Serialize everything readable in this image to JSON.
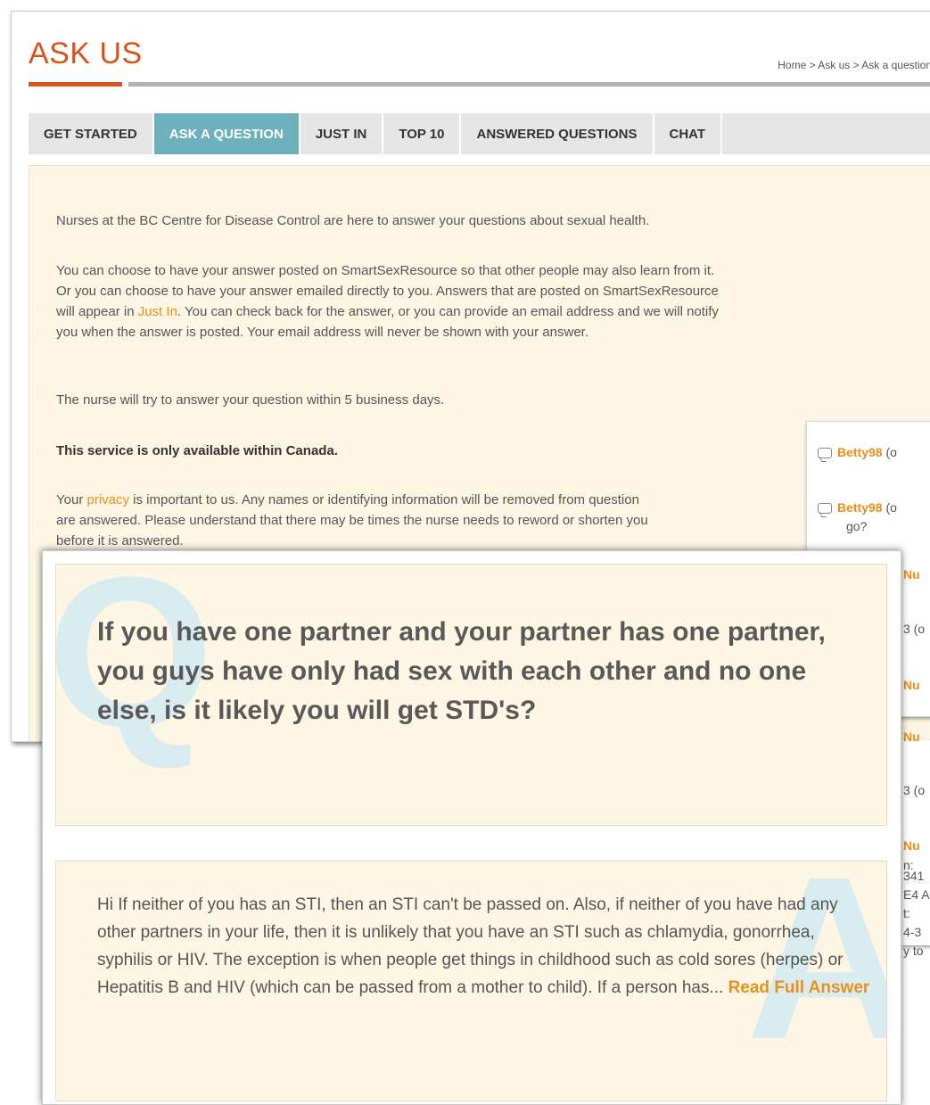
{
  "page": {
    "title": "ASK US",
    "breadcrumb": "Home > Ask us > Ask a question"
  },
  "tabs": [
    {
      "label": "GET STARTED",
      "active": false
    },
    {
      "label": "ASK A QUESTION",
      "active": true
    },
    {
      "label": "JUST IN",
      "active": false
    },
    {
      "label": "TOP 10",
      "active": false
    },
    {
      "label": "ANSWERED QUESTIONS",
      "active": false
    },
    {
      "label": "CHAT",
      "active": false
    }
  ],
  "intro": {
    "p1": "Nurses at the BC Centre for Disease Control are here to answer your questions about sexual health.",
    "p2_line1": "You can choose to have your answer posted on SmartSexResource so that other people may also learn from it.",
    "p2_line2": "Or you can choose to have your answer emailed directly to you. Answers that are posted on SmartSexResource",
    "p2_line3_pre": "will appear in ",
    "p2_line3_link": "Just In",
    "p2_line3_post": ". You can check back for the answer, or you can provide an email address and we will notify",
    "p2_line4": "you when the answer is posted. Your email address will never be shown with your answer.",
    "p3": "The nurse will try to answer your question within 5 business days.",
    "p4": "This service is only available within Canada.",
    "p5_line1_pre": "Your ",
    "p5_line1_link": "privacy",
    "p5_line1_post": " is important to us. Any names or identifying information will be removed from question",
    "p5_line2": "are answered. Please understand that there may be times the nurse needs to reword or shorten you",
    "p5_line3": "before it is answered."
  },
  "side_panel": {
    "comments": [
      {
        "user": "Betty98",
        "suffix": "(o"
      },
      {
        "user": "Betty98",
        "suffix": "(o",
        "extra": "go?"
      }
    ],
    "snippets": [
      "Nu",
      "3 (o",
      "Nu",
      "Nu",
      "3 (o",
      "Nu",
      "n:",
      "341",
      "E4 A",
      "t:",
      "4-3",
      "y to"
    ]
  },
  "question": {
    "text": "If you have one partner and your partner has one partner, you guys have only had sex with each other and no one else, is it likely you will get STD's?",
    "watermark": "Q"
  },
  "answer": {
    "text": "Hi If neither of you has an STI, then an STI can't be passed on. Also, if neither of you have had any other partners in your life, then it is unlikely that you have an STI such as chlamydia, gonorrhea, syphilis or HIV. The exception is when people get things in childhood such as cold sores (herpes) or Hepatitis B and HIV (which can be passed from a mother to child).  If a person has...",
    "read_more": "Read Full Answer",
    "watermark": "A"
  },
  "colors": {
    "brand_orange": "#d9541b",
    "link_orange": "#e8901a",
    "active_tab": "#6db1bd",
    "panel_bg": "#fdf6e5"
  }
}
